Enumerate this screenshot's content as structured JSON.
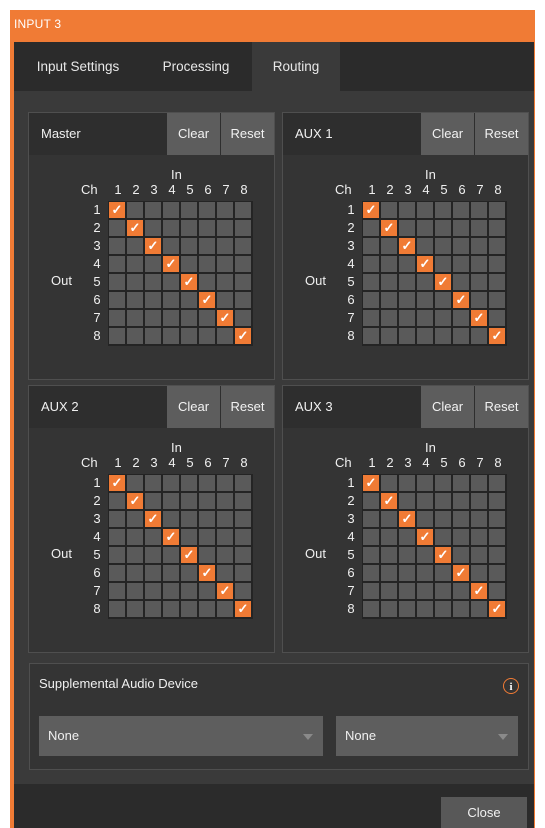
{
  "window": {
    "title": "INPUT 3"
  },
  "tabs": [
    {
      "label": "Input Settings"
    },
    {
      "label": "Processing"
    },
    {
      "label": "Routing",
      "active": true
    }
  ],
  "routing": {
    "clear_label": "Clear",
    "reset_label": "Reset",
    "in_label": "In",
    "ch_label": "Ch",
    "out_label": "Out",
    "channels": [
      "1",
      "2",
      "3",
      "4",
      "5",
      "6",
      "7",
      "8"
    ],
    "panels": [
      {
        "name": "Master",
        "routes": [
          [
            1,
            1
          ],
          [
            2,
            2
          ],
          [
            3,
            3
          ],
          [
            4,
            4
          ],
          [
            5,
            5
          ],
          [
            6,
            6
          ],
          [
            7,
            7
          ],
          [
            8,
            8
          ]
        ]
      },
      {
        "name": "AUX 1",
        "routes": [
          [
            1,
            1
          ],
          [
            2,
            2
          ],
          [
            3,
            3
          ],
          [
            4,
            4
          ],
          [
            5,
            5
          ],
          [
            6,
            6
          ],
          [
            7,
            7
          ],
          [
            8,
            8
          ]
        ]
      },
      {
        "name": "AUX 2",
        "routes": [
          [
            1,
            1
          ],
          [
            2,
            2
          ],
          [
            3,
            3
          ],
          [
            4,
            4
          ],
          [
            5,
            5
          ],
          [
            6,
            6
          ],
          [
            7,
            7
          ],
          [
            8,
            8
          ]
        ]
      },
      {
        "name": "AUX 3",
        "routes": [
          [
            1,
            1
          ],
          [
            2,
            2
          ],
          [
            3,
            3
          ],
          [
            4,
            4
          ],
          [
            5,
            5
          ],
          [
            6,
            6
          ],
          [
            7,
            7
          ],
          [
            8,
            8
          ]
        ]
      }
    ]
  },
  "supplemental": {
    "title": "Supplemental Audio Device",
    "info_icon": "info-icon",
    "select_left": "None",
    "select_right": "None"
  },
  "footer": {
    "close_label": "Close"
  },
  "colors": {
    "accent": "#f07b35",
    "background": "#3a3a3a",
    "panel": "#343434",
    "button": "#5d5d5d"
  }
}
